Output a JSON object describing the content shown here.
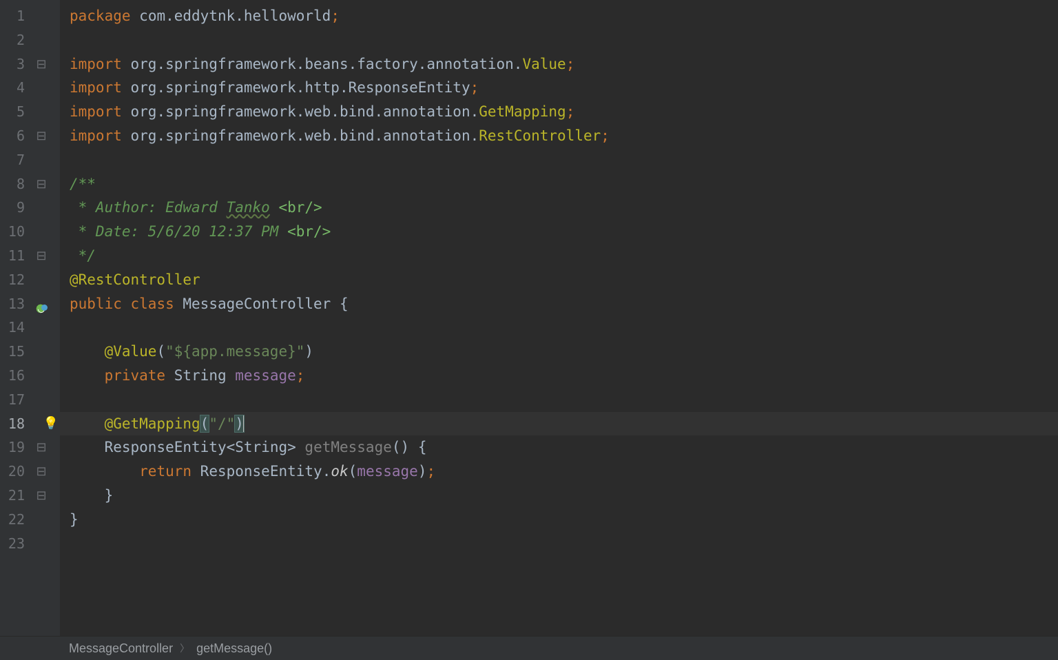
{
  "breadcrumbs": {
    "class": "MessageController",
    "method": "getMessage()"
  },
  "gutter": {
    "line_count": 23,
    "current_line": 18,
    "spring_icon_line": 13,
    "bulb_line": 18,
    "fold_markers": {
      "3": "⊟",
      "6": "⊟",
      "8": "⊟",
      "11": "⊟",
      "13": "",
      "18": "",
      "19": "⊟",
      "20": "⊟",
      "21": "⊟"
    }
  },
  "code": {
    "l1": {
      "kw": "package",
      "sp": " ",
      "pkg": "com.eddytnk.helloworld",
      "semi": ";"
    },
    "l2": {
      "blank": ""
    },
    "l3": {
      "kw": "import",
      "sp": " ",
      "pkg": "org.springframework.beans.factory.annotation.",
      "tgt": "Value",
      "semi": ";"
    },
    "l4": {
      "kw": "import",
      "sp": " ",
      "pkg": "org.springframework.http.ResponseEntity",
      "semi": ";"
    },
    "l5": {
      "kw": "import",
      "sp": " ",
      "pkg": "org.springframework.web.bind.annotation.",
      "tgt": "GetMapping",
      "semi": ";"
    },
    "l6": {
      "kw": "import",
      "sp": " ",
      "pkg": "org.springframework.web.bind.annotation.",
      "tgt": "RestController",
      "semi": ";"
    },
    "l7": {
      "blank": ""
    },
    "l8": {
      "doc": "/**"
    },
    "l9": {
      "doc_pre": " * Author: Edward ",
      "doc_wavy": "Tanko",
      "doc_post": " ",
      "html": "<br/>"
    },
    "l10": {
      "doc_pre": " * Date: 5/6/20 12:37 PM ",
      "html": "<br/>"
    },
    "l11": {
      "doc": " */"
    },
    "l12": {
      "ann": "@RestController"
    },
    "l13": {
      "kw1": "public",
      "sp1": " ",
      "kw2": "class",
      "sp2": " ",
      "cls": "MessageController",
      "sp3": " ",
      "brace": "{"
    },
    "l14": {
      "blank": ""
    },
    "l15": {
      "indent": "    ",
      "ann": "@Value",
      "paren1": "(",
      "str": "\"${app.message}\"",
      "paren2": ")"
    },
    "l16": {
      "indent": "    ",
      "kw": "private",
      "sp": " ",
      "type": "String",
      "sp2": " ",
      "field": "message",
      "semi": ";"
    },
    "l17": {
      "blank": ""
    },
    "l18": {
      "indent": "    ",
      "ann": "@GetMapping",
      "paren1": "(",
      "str": "\"/\"",
      "paren2": ")"
    },
    "l19": {
      "indent": "    ",
      "type": "ResponseEntity",
      "lt": "<",
      "gtype": "String",
      "gt": ">",
      "sp": " ",
      "mname": "getMessage",
      "parens": "()",
      "sp2": " ",
      "brace": "{"
    },
    "l20": {
      "indent": "        ",
      "kw": "return",
      "sp": " ",
      "type": "ResponseEntity",
      "dot": ".",
      "sm": "ok",
      "paren1": "(",
      "field": "message",
      "paren2": ")",
      "semi": ";"
    },
    "l21": {
      "indent": "    ",
      "brace": "}"
    },
    "l22": {
      "brace": "}"
    },
    "l23": {
      "blank": ""
    }
  }
}
